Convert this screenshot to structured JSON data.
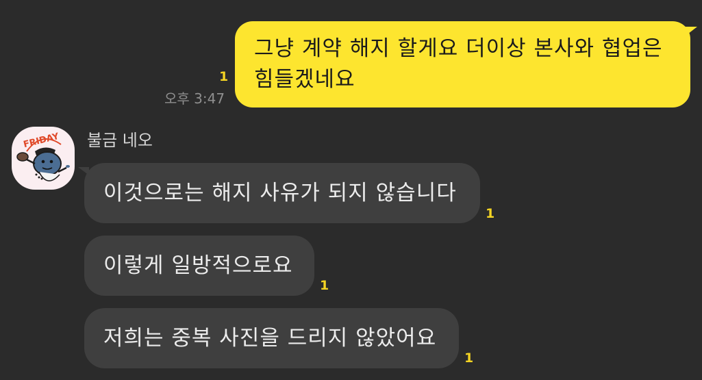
{
  "chat": {
    "outgoing": [
      {
        "text_line1": "그냥 계약 해지 할게요 더이상 본사와 협업은",
        "text_line2": "힘들겠네요",
        "unread": "1",
        "time": "오후 3:47"
      }
    ],
    "incoming": {
      "sender_name": "불금 네오",
      "avatar_caption": "FRIDAY",
      "messages": [
        {
          "text": "이것으로는 해지 사유가 되지 않습니다",
          "unread": "1"
        },
        {
          "text": "이렇게 일방적으로요",
          "unread": "1"
        },
        {
          "text": "저희는 중복 사진을 드리지 않았어요",
          "unread": "1"
        }
      ]
    }
  },
  "colors": {
    "background": "#2b2b2b",
    "outgoing_bubble": "#fde52f",
    "incoming_bubble": "#3f3f3f",
    "unread_badge": "#f4d423"
  }
}
